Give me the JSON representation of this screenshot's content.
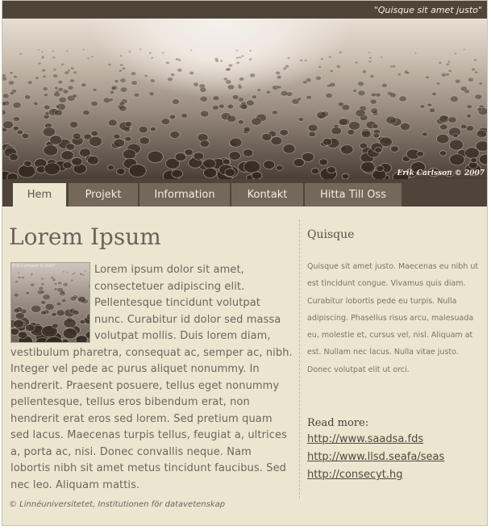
{
  "header": {
    "slogan": "\"Quisque sit amet justo\"",
    "banner_credit": "Erik Carlsson © 2007"
  },
  "nav": {
    "tabs": [
      {
        "label": "Hem",
        "active": true
      },
      {
        "label": "Projekt",
        "active": false
      },
      {
        "label": "Information",
        "active": false
      },
      {
        "label": "Kontakt",
        "active": false
      },
      {
        "label": "Hitta Till Oss",
        "active": false
      }
    ]
  },
  "main": {
    "heading": "Lorem Ipsum",
    "thumb_credit": "Erik Carlsson © 2007",
    "body": "Lorem ipsum dolor sit amet, consectetuer adipiscing elit. Pellentesque tincidunt volutpat nunc. Curabitur id dolor sed massa volutpat mollis. Duis lorem diam, vestibulum pharetra, consequat ac, semper ac, nibh. Integer vel pede ac purus aliquet nonummy. In hendrerit. Praesent posuere, tellus eget nonummy pellentesque, tellus eros bibendum erat, non hendrerit erat eros sed lorem. Sed pretium quam sed lacus. Maecenas turpis tellus, feugiat a, ultrices a, porta ac, nisi. Donec convallis neque. Nam lobortis nibh sit amet metus tincidunt faucibus. Sed nec leo. Aliquam mattis."
  },
  "sidebar": {
    "title": "Quisque",
    "text": "Quisque sit amet justo. Maecenas eu nibh ut est tincidunt congue. Vivamus quis diam. Curabitur lobortis pede eu turpis. Nulla adipiscing. Phasellus risus arcu, malesuada eu, molestie et, cursus vel, nisl. Aliquam at est. Nullam nec lacus. Nulla vitae justo. Donec volutpat elit ut orci.",
    "readmore_label": "Read more:",
    "links": [
      "http://www.saadsa.fds",
      "http://www.llsd.seafa/seas",
      "http://consecyt.hg"
    ]
  },
  "footer": {
    "text": "© Linnéuniversitetet, Institutionen för datavetenskap"
  },
  "colors": {
    "dark_bar": "#4f4439",
    "tab": "#736859",
    "page_bg": "#ebe6d0"
  }
}
